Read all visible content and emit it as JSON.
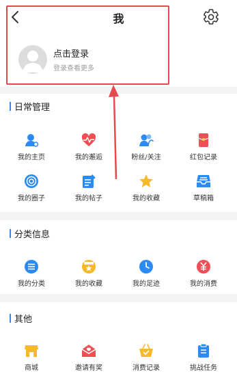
{
  "header": {
    "title": "我",
    "back_icon": "chevron-left-icon",
    "settings_icon": "gear-icon"
  },
  "profile": {
    "login_title": "点击登录",
    "login_subtitle": "登录查看更多"
  },
  "annotation": {
    "highlight_color": "#e5484d"
  },
  "sections": [
    {
      "title": "日常管理",
      "items": [
        {
          "label": "我的主页",
          "icon": "user-icon",
          "color": "#2c8bf2"
        },
        {
          "label": "我的邂逅",
          "icon": "heartbeat-icon",
          "color": "#ef4f55"
        },
        {
          "label": "粉丝/关注",
          "icon": "fans-icon",
          "color": "#2c8bf2"
        },
        {
          "label": "红包记录",
          "icon": "red-packet-icon",
          "color": "#ef4f55"
        },
        {
          "label": "我的圈子",
          "icon": "circle-target-icon",
          "color": "#2c8bf2"
        },
        {
          "label": "我的帖子",
          "icon": "post-edit-icon",
          "color": "#2c8bf2"
        },
        {
          "label": "我的收藏",
          "icon": "star-icon",
          "color": "#f7b92c"
        },
        {
          "label": "草稿箱",
          "icon": "drafts-tray-icon",
          "color": "#2c8bf2"
        }
      ]
    },
    {
      "title": "分类信息",
      "items": [
        {
          "label": "我的分类",
          "icon": "category-list-icon",
          "color": "#2c8bf2"
        },
        {
          "label": "我的收藏",
          "icon": "star-circle-icon",
          "color": "#f7b92c"
        },
        {
          "label": "我的足迹",
          "icon": "clock-icon",
          "color": "#2c8bf2"
        },
        {
          "label": "我的消费",
          "icon": "yen-icon",
          "color": "#ef4f55"
        }
      ]
    },
    {
      "title": "其他",
      "items": [
        {
          "label": "商城",
          "icon": "shop-icon",
          "color": "#f7b92c"
        },
        {
          "label": "邀请有奖",
          "icon": "invite-mail-icon",
          "color": "#ef4f55"
        },
        {
          "label": "消费记录",
          "icon": "basket-icon",
          "color": "#f7b92c"
        },
        {
          "label": "挑战任务",
          "icon": "clipboard-icon",
          "color": "#2c8bf2"
        }
      ]
    }
  ]
}
